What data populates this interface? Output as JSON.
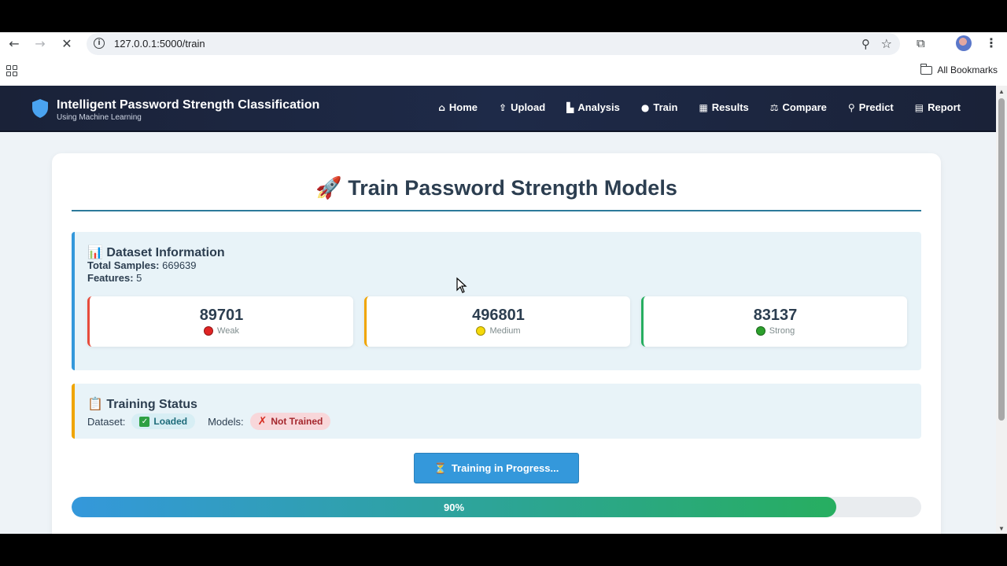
{
  "browser": {
    "url": "127.0.0.1:5000/train",
    "bookmarks_label": "All Bookmarks"
  },
  "nav": {
    "brand_title": "Intelligent Password Strength Classification",
    "brand_subtitle": "Using Machine Learning",
    "links": [
      {
        "label": "Home",
        "icon": "home-icon"
      },
      {
        "label": "Upload",
        "icon": "upload-icon"
      },
      {
        "label": "Analysis",
        "icon": "chart-icon"
      },
      {
        "label": "Train",
        "icon": "brain-icon"
      },
      {
        "label": "Results",
        "icon": "table-icon"
      },
      {
        "label": "Compare",
        "icon": "scale-icon"
      },
      {
        "label": "Predict",
        "icon": "search-icon"
      },
      {
        "label": "Report",
        "icon": "file-icon"
      }
    ]
  },
  "page": {
    "title_icon": "🚀",
    "title": "Train Password Strength Models"
  },
  "dataset": {
    "icon": "📊",
    "title": "Dataset Information",
    "total_label": "Total Samples:",
    "total_value": "669639",
    "features_label": "Features:",
    "features_value": "5",
    "classes": [
      {
        "count": "89701",
        "label": "Weak",
        "color": "#e02424",
        "border": "#e74c3c"
      },
      {
        "count": "496801",
        "label": "Medium",
        "color": "#f5d90a",
        "border": "#f0a500"
      },
      {
        "count": "83137",
        "label": "Strong",
        "color": "#2ca02c",
        "border": "#27ae60"
      }
    ]
  },
  "training_status": {
    "icon": "📋",
    "title": "Training Status",
    "dataset_label": "Dataset:",
    "dataset_status": "Loaded",
    "models_label": "Models:",
    "models_status": "Not Trained"
  },
  "train_button": {
    "icon": "⏳",
    "label": "Training in Progress..."
  },
  "progress": {
    "percent": 90,
    "label": "90%"
  }
}
